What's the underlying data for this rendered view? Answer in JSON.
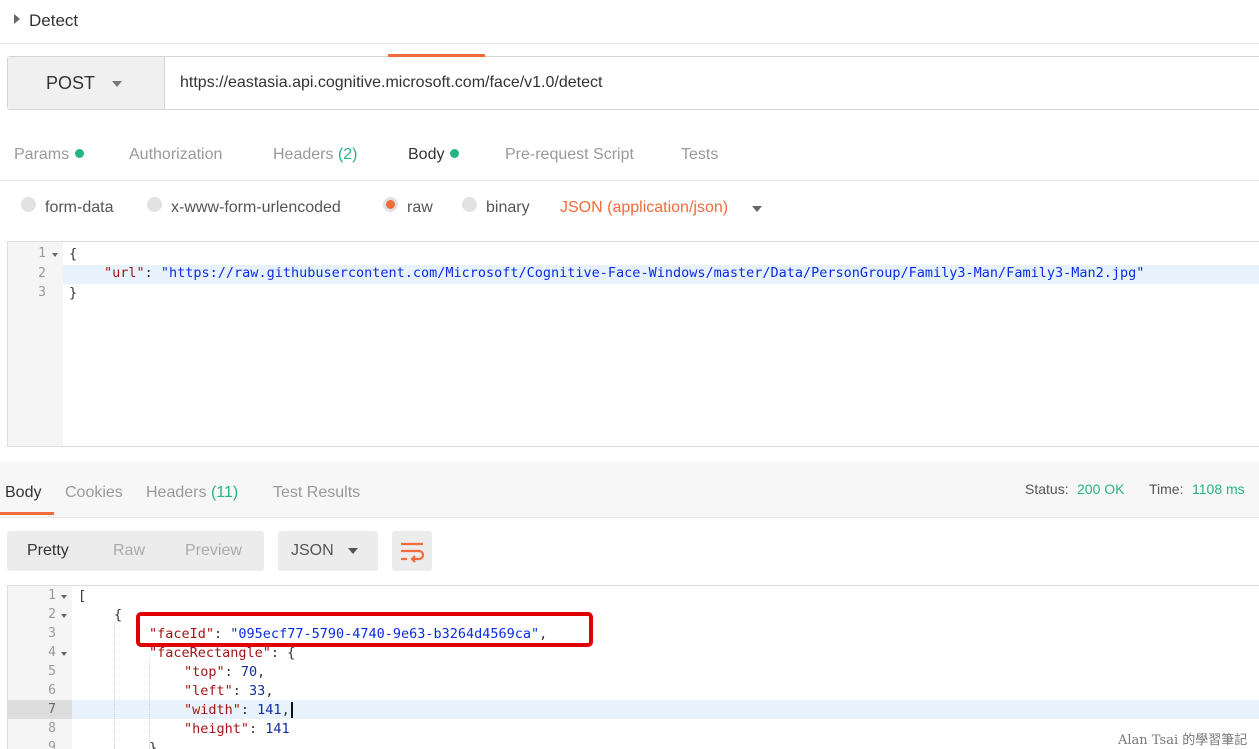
{
  "request": {
    "title": "Detect",
    "method": "POST",
    "url": "https://eastasia.api.cognitive.microsoft.com/face/v1.0/detect",
    "tabs": [
      {
        "label": "Params",
        "dot": true
      },
      {
        "label": "Authorization"
      },
      {
        "label": "Headers",
        "count": "(2)"
      },
      {
        "label": "Body",
        "dot": true,
        "active": true
      },
      {
        "label": "Pre-request Script"
      },
      {
        "label": "Tests"
      }
    ],
    "body_types": [
      {
        "label": "form-data",
        "selected": false
      },
      {
        "label": "x-www-form-urlencoded",
        "selected": false
      },
      {
        "label": "raw",
        "selected": true
      },
      {
        "label": "binary",
        "selected": false
      }
    ],
    "content_type": "JSON (application/json)",
    "editor": {
      "line_numbers": [
        "1",
        "2",
        "3"
      ],
      "open_brace": "{",
      "close_brace": "}",
      "url_key": "\"url\"",
      "url_value": "\"https://raw.githubusercontent.com/Microsoft/Cognitive-Face-Windows/master/Data/PersonGroup/Family3-Man/Family3-Man2.jpg\""
    }
  },
  "response": {
    "tabs": [
      {
        "label": "Body",
        "active": true
      },
      {
        "label": "Cookies"
      },
      {
        "label": "Headers",
        "count": "(11)"
      },
      {
        "label": "Test Results"
      }
    ],
    "status_label": "Status:",
    "status_value": "200 OK",
    "time_label": "Time:",
    "time_value": "1108 ms",
    "views": [
      "Pretty",
      "Raw",
      "Preview"
    ],
    "active_view": "Pretty",
    "format": "JSON",
    "wrap_icon": "wrap-lines-icon",
    "editor": {
      "line_numbers": [
        "1",
        "2",
        "3",
        "4",
        "5",
        "6",
        "7",
        "8",
        "9"
      ],
      "open_bracket": "[",
      "open_brace": "{",
      "faceId_key": "\"faceId\"",
      "faceId_value": "\"095ecf77-5790-4740-9e63-b3264d4569ca\"",
      "faceRectangle_key": "\"faceRectangle\"",
      "top_key": "\"top\"",
      "top_value": "70",
      "left_key": "\"left\"",
      "left_value": "33",
      "width_key": "\"width\"",
      "width_value": "141",
      "height_key": "\"height\"",
      "height_value": "141",
      "close_brace": "}"
    }
  },
  "watermark": "Alan Tsai 的學習筆記",
  "colors": {
    "accent": "#f26b3a",
    "success": "#26b47f",
    "highlight_box": "#e00000"
  }
}
